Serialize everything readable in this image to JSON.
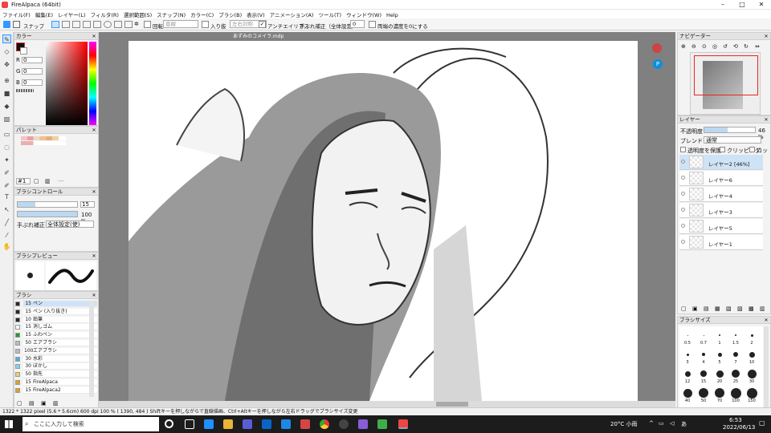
{
  "window": {
    "title": "FireAlpaca (64bit)"
  },
  "menu": [
    "ファイル(F)",
    "編集(E)",
    "レイヤー(L)",
    "フィルタ(R)",
    "選択範囲(S)",
    "スナップ(N)",
    "カラー(C)",
    "ブラシ(B)",
    "表示(V)",
    "アニメーション(A)",
    "ツール(T)",
    "ウィンドウ(W)",
    "Help"
  ],
  "toolbar": {
    "snap_label": "スナップ",
    "rotate_label": "回転",
    "rotate_value": "直線",
    "halftone_label": "入り抜",
    "halftone_value": "左右対称",
    "antialias_label": "アンチエイリアス",
    "correction_label": "手ぶれ補正（全体設定）",
    "correction_value": "0",
    "edge_label": "両端の濃度を0にする"
  },
  "color_panel": {
    "title": "カラー",
    "r_label": "R",
    "r_value": "0",
    "g_label": "G",
    "g_value": "0",
    "b_label": "B",
    "b_value": "0"
  },
  "palette_panel": {
    "title": "パレット",
    "page": "#1"
  },
  "brush_control": {
    "title": "ブラシコントロール",
    "size_value": "15",
    "opacity_value": "100 %",
    "correction_label": "手ぶれ補正",
    "correction_value": "全体設定(使)"
  },
  "brush_preview": {
    "title": "ブラシプレビュー"
  },
  "brush_panel": {
    "title": "ブラシ",
    "items": [
      {
        "size": "15",
        "name": "ペン",
        "color": "#2a2a2a",
        "selected": true
      },
      {
        "size": "15",
        "name": "ペン (入り抜き)",
        "color": "#2a2a2a"
      },
      {
        "size": "10",
        "name": "鉛筆",
        "color": "#2a2a2a"
      },
      {
        "size": "15",
        "name": "消しゴム",
        "color": "#ffffff"
      },
      {
        "size": "15",
        "name": "ふわペン",
        "color": "#2a9a2a"
      },
      {
        "size": "50",
        "name": "エアブラシ",
        "color": "#bbbbbb"
      },
      {
        "size": "100",
        "name": "エアブラシ",
        "color": "#bbbbbb"
      },
      {
        "size": "30",
        "name": "水彩",
        "color": "#4ab0e0"
      },
      {
        "size": "30",
        "name": "ぼかし",
        "color": "#8ad0f0"
      },
      {
        "size": "50",
        "name": "指先",
        "color": "#e6d070"
      },
      {
        "size": "15",
        "name": "FireAlpaca",
        "color": "#e0a020"
      },
      {
        "size": "15",
        "name": "FireAlpaca2",
        "color": "#e0a020"
      }
    ]
  },
  "document": {
    "tab": "あずみのコメイラ.mdp"
  },
  "navigator": {
    "title": "ナビゲーター"
  },
  "layer_panel": {
    "title": "レイヤー",
    "opacity_label": "不透明度",
    "opacity_value": "46 %",
    "opacity_fraction": 0.46,
    "blend_label": "ブレンド",
    "blend_value": "通常",
    "protect_label": "透明度を保護",
    "clipping_label": "クリッピング",
    "lock_label": "ロック",
    "layers": [
      {
        "name": "レイヤー2 [46%]",
        "selected": true
      },
      {
        "name": "レイヤー6"
      },
      {
        "name": "レイヤー4"
      },
      {
        "name": "レイヤー3"
      },
      {
        "name": "レイヤー5"
      },
      {
        "name": "レイヤー1"
      }
    ]
  },
  "brush_size_panel": {
    "title": "ブラシサイズ",
    "labels_row1": [
      "0.5",
      "0.7",
      "1",
      "1.5",
      "2"
    ],
    "labels_row2": [
      "3",
      "4",
      "5",
      "7",
      "10"
    ],
    "labels_row3": [
      "12",
      "15",
      "20",
      "25",
      "30"
    ],
    "labels_row4": [
      "40",
      "50",
      "70",
      "100",
      "150"
    ]
  },
  "status": {
    "text": "1322 * 1322 pixel  (5.6 * 5.6cm)  600 dpi  100 %  ( 1390, 484 )  Shiftキーを押しながらで直線描画、Ctrl+Altキーを押しながら左右ドラッグでブラシサイズ変更"
  },
  "taskbar": {
    "search_placeholder": "ここに入力して検索",
    "weather": "20°C 小雨",
    "time": "6:53",
    "date": "2022/06/13"
  },
  "colors": {
    "accent": "#0078d7",
    "selected_layer": "#cfe3f7",
    "taskbar": "#1c1c1c"
  }
}
